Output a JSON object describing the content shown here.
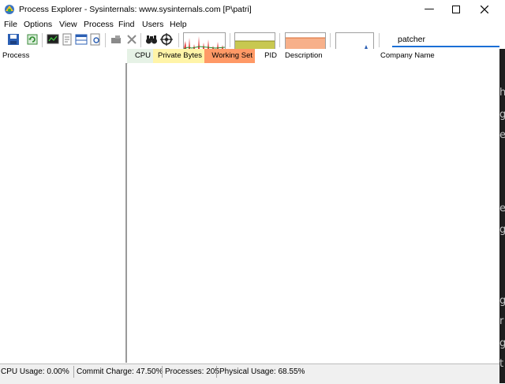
{
  "window": {
    "title": "Process Explorer - Sysinternals: www.sysinternals.com [P\\patri]",
    "controls": {
      "minimize_icon": "minimize-icon",
      "maximize_icon": "maximize-icon",
      "close_icon": "close-icon"
    }
  },
  "menu": [
    "File",
    "Options",
    "View",
    "Process",
    "Find",
    "Users",
    "Help"
  ],
  "toolbar": {
    "buttons": [
      "save-icon",
      "refresh-icon",
      "system-info-icon",
      "properties-icon",
      "lower-pane-icon",
      "dll-view-icon",
      "kill-process-icon",
      "close-icon",
      "find-binoculars-icon",
      "target-crosshair-icon"
    ],
    "graphs": [
      "cpu-graph",
      "commit-graph",
      "physical-memory-graph",
      "io-graph"
    ],
    "search_value": "patcher"
  },
  "columns": {
    "process": "Process",
    "cpu": "CPU",
    "private_bytes": "Private Bytes",
    "working_set": "Working Set",
    "pid": "PID",
    "description": "Description",
    "company": "Company Name"
  },
  "column_colors": {
    "cpu": "#e6f2e6",
    "private_bytes": "#fff4a8",
    "working_set": "#ff9966"
  },
  "status": {
    "cpu": "CPU Usage: 0.00%",
    "commit": "Commit Charge: 47.50%",
    "processes": "Processes: 205",
    "physical": "Physical Usage: 68.55%"
  },
  "background_window_letters": [
    "h",
    "g",
    "e",
    "e",
    "g",
    "g",
    "r",
    "g",
    "t"
  ]
}
